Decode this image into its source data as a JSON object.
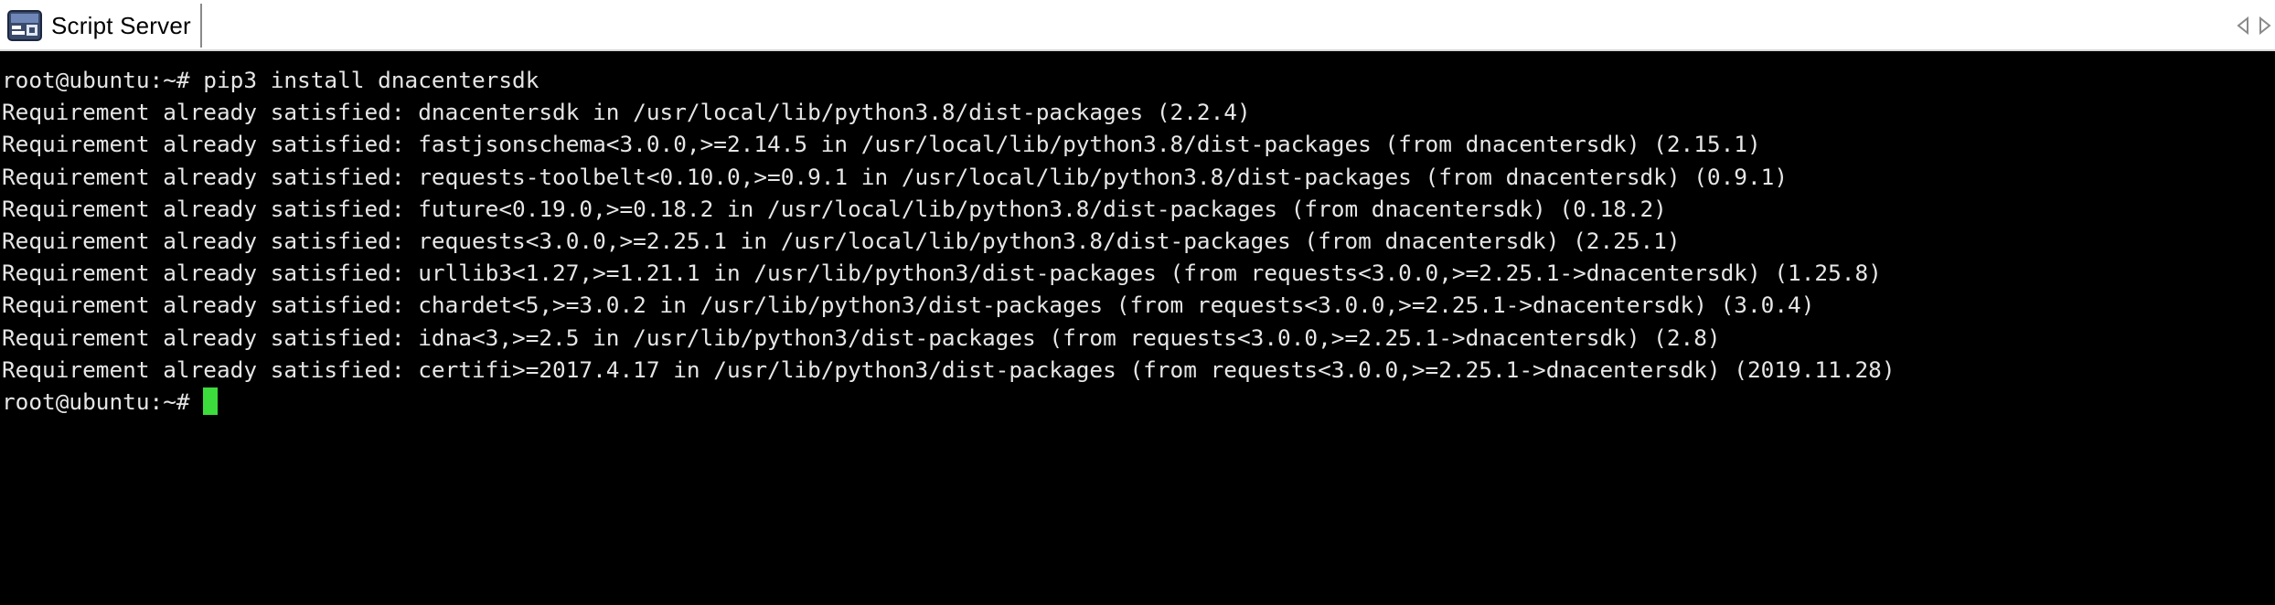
{
  "window": {
    "tab_title": "Script Server",
    "icon": "terminal-app-icon",
    "scroll_left_icon": "chevron-left-icon",
    "scroll_right_icon": "chevron-right-icon"
  },
  "terminal": {
    "background": "#000000",
    "foreground": "#e6e6e6",
    "cursor_color": "#3cdc3c",
    "lines": [
      "root@ubuntu:~# pip3 install dnacentersdk",
      "Requirement already satisfied: dnacentersdk in /usr/local/lib/python3.8/dist-packages (2.2.4)",
      "Requirement already satisfied: fastjsonschema<3.0.0,>=2.14.5 in /usr/local/lib/python3.8/dist-packages (from dnacentersdk) (2.15.1)",
      "Requirement already satisfied: requests-toolbelt<0.10.0,>=0.9.1 in /usr/local/lib/python3.8/dist-packages (from dnacentersdk) (0.9.1)",
      "Requirement already satisfied: future<0.19.0,>=0.18.2 in /usr/local/lib/python3.8/dist-packages (from dnacentersdk) (0.18.2)",
      "Requirement already satisfied: requests<3.0.0,>=2.25.1 in /usr/local/lib/python3.8/dist-packages (from dnacentersdk) (2.25.1)",
      "Requirement already satisfied: urllib3<1.27,>=1.21.1 in /usr/lib/python3/dist-packages (from requests<3.0.0,>=2.25.1->dnacentersdk) (1.25.8)",
      "Requirement already satisfied: chardet<5,>=3.0.2 in /usr/lib/python3/dist-packages (from requests<3.0.0,>=2.25.1->dnacentersdk) (3.0.4)",
      "Requirement already satisfied: idna<3,>=2.5 in /usr/lib/python3/dist-packages (from requests<3.0.0,>=2.25.1->dnacentersdk) (2.8)",
      "Requirement already satisfied: certifi>=2017.4.17 in /usr/lib/python3/dist-packages (from requests<3.0.0,>=2.25.1->dnacentersdk) (2019.11.28)"
    ],
    "prompt": "root@ubuntu:~# "
  }
}
